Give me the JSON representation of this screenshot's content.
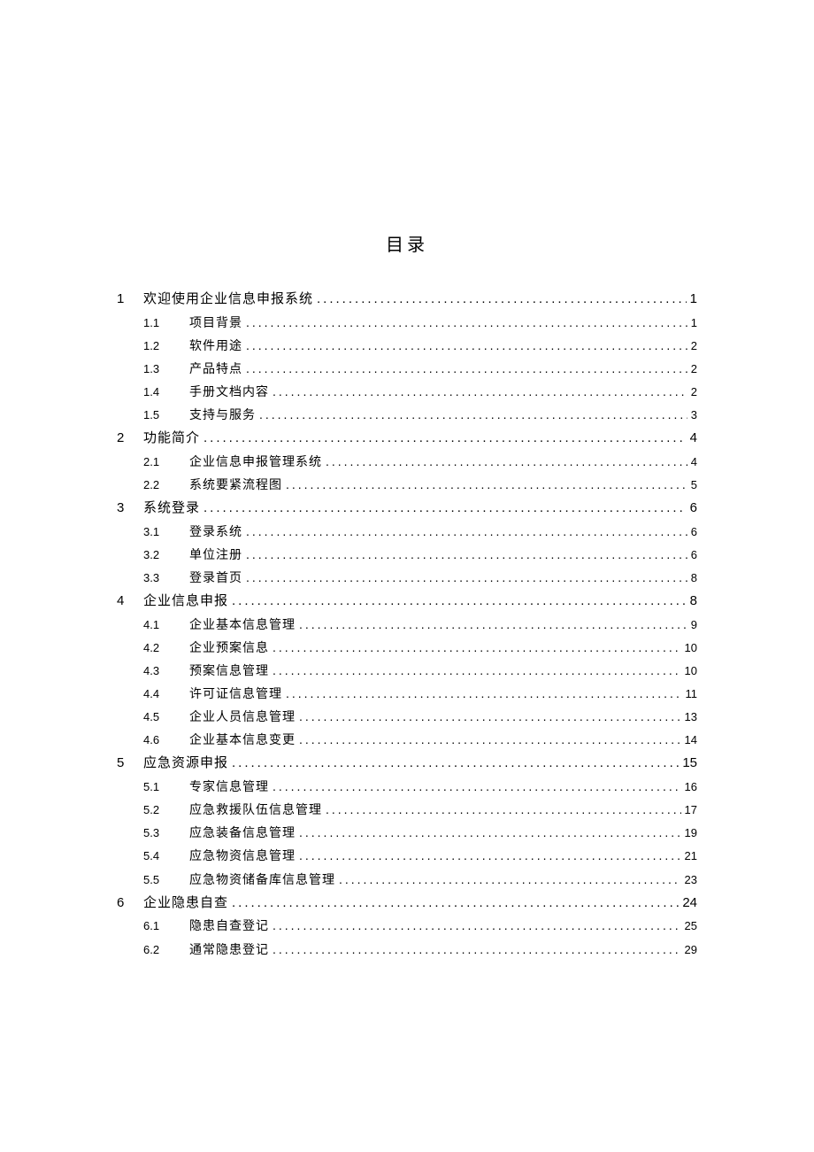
{
  "title": "目录",
  "entries": [
    {
      "level": 1,
      "num": "1",
      "label": "欢迎使用企业信息申报系统",
      "page": "1"
    },
    {
      "level": 2,
      "num": "1.1",
      "label": "项目背景",
      "page": "1"
    },
    {
      "level": 2,
      "num": "1.2",
      "label": "软件用途",
      "page": "2"
    },
    {
      "level": 2,
      "num": "1.3",
      "label": "产品特点",
      "page": "2"
    },
    {
      "level": 2,
      "num": "1.4",
      "label": "手册文档内容",
      "page": "2"
    },
    {
      "level": 2,
      "num": "1.5",
      "label": "支持与服务",
      "page": "3"
    },
    {
      "level": 1,
      "num": "2",
      "label": "功能简介",
      "page": "4"
    },
    {
      "level": 2,
      "num": "2.1",
      "label": "企业信息申报管理系统",
      "page": "4"
    },
    {
      "level": 2,
      "num": "2.2",
      "label": "系统要紧流程图",
      "page": "5"
    },
    {
      "level": 1,
      "num": "3",
      "label": "系统登录",
      "page": "6"
    },
    {
      "level": 2,
      "num": "3.1",
      "label": "登录系统",
      "page": "6"
    },
    {
      "level": 2,
      "num": "3.2",
      "label": "单位注册",
      "page": "6"
    },
    {
      "level": 2,
      "num": "3.3",
      "label": "登录首页",
      "page": "8"
    },
    {
      "level": 1,
      "num": "4",
      "label": "企业信息申报",
      "page": "8"
    },
    {
      "level": 2,
      "num": "4.1",
      "label": "企业基本信息管理",
      "page": "9"
    },
    {
      "level": 2,
      "num": "4.2",
      "label": "企业预案信息",
      "page": "10"
    },
    {
      "level": 2,
      "num": "4.3",
      "label": "预案信息管理",
      "page": "10"
    },
    {
      "level": 2,
      "num": "4.4",
      "label": "许可证信息管理",
      "page": "11"
    },
    {
      "level": 2,
      "num": "4.5",
      "label": "企业人员信息管理",
      "page": "13"
    },
    {
      "level": 2,
      "num": "4.6",
      "label": "企业基本信息变更",
      "page": "14"
    },
    {
      "level": 1,
      "num": "5",
      "label": "应急资源申报",
      "page": "15"
    },
    {
      "level": 2,
      "num": "5.1",
      "label": "专家信息管理",
      "page": "16"
    },
    {
      "level": 2,
      "num": "5.2",
      "label": "应急救援队伍信息管理",
      "page": "17"
    },
    {
      "level": 2,
      "num": "5.3",
      "label": "应急装备信息管理",
      "page": "19"
    },
    {
      "level": 2,
      "num": "5.4",
      "label": "应急物资信息管理",
      "page": "21"
    },
    {
      "level": 2,
      "num": "5.5",
      "label": "应急物资储备库信息管理",
      "page": "23"
    },
    {
      "level": 1,
      "num": "6",
      "label": "企业隐患自查",
      "page": "24"
    },
    {
      "level": 2,
      "num": "6.1",
      "label": "隐患自查登记",
      "page": "25"
    },
    {
      "level": 2,
      "num": "6.2",
      "label": "通常隐患登记",
      "page": "29"
    }
  ]
}
